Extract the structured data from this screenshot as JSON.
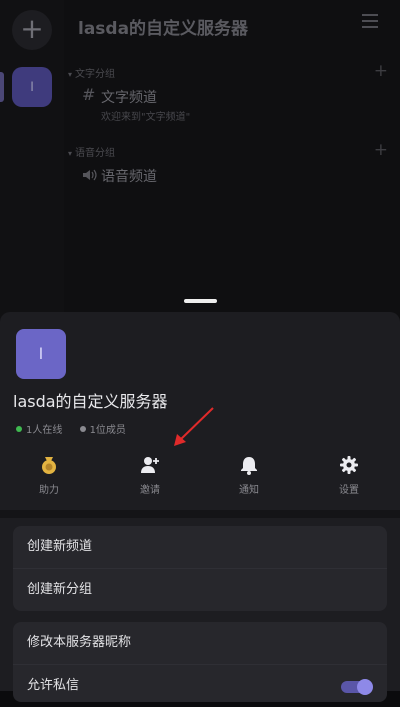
{
  "background": {
    "rail": {
      "add_label": "+",
      "server_initial": "l"
    },
    "header": {
      "title": "lasda的自定义服务器"
    },
    "groups": [
      {
        "label": "文字分组",
        "channels": [
          {
            "name": "文字频道",
            "description": "欢迎来到\"文字频道\""
          }
        ]
      },
      {
        "label": "语音分组",
        "channels": [
          {
            "name": "语音频道"
          }
        ]
      }
    ]
  },
  "sheet": {
    "server_initial": "l",
    "server_name": "lasda的自定义服务器",
    "online_text": "1人在线",
    "members_text": "1位成员",
    "actions": [
      {
        "label": "助力",
        "icon": "boost-medal-icon"
      },
      {
        "label": "邀请",
        "icon": "invite-user-icon"
      },
      {
        "label": "通知",
        "icon": "bell-icon"
      },
      {
        "label": "设置",
        "icon": "gear-icon"
      }
    ],
    "channel_menu": [
      "创建新频道",
      "创建新分组"
    ],
    "server_menu": [
      "修改本服务器昵称",
      "允许私信"
    ],
    "allow_dm": true
  },
  "colors": {
    "accent": "#6b66c6",
    "online": "#3fb950",
    "members": "#8a8a90",
    "annotation_arrow": "#e02a2a"
  }
}
